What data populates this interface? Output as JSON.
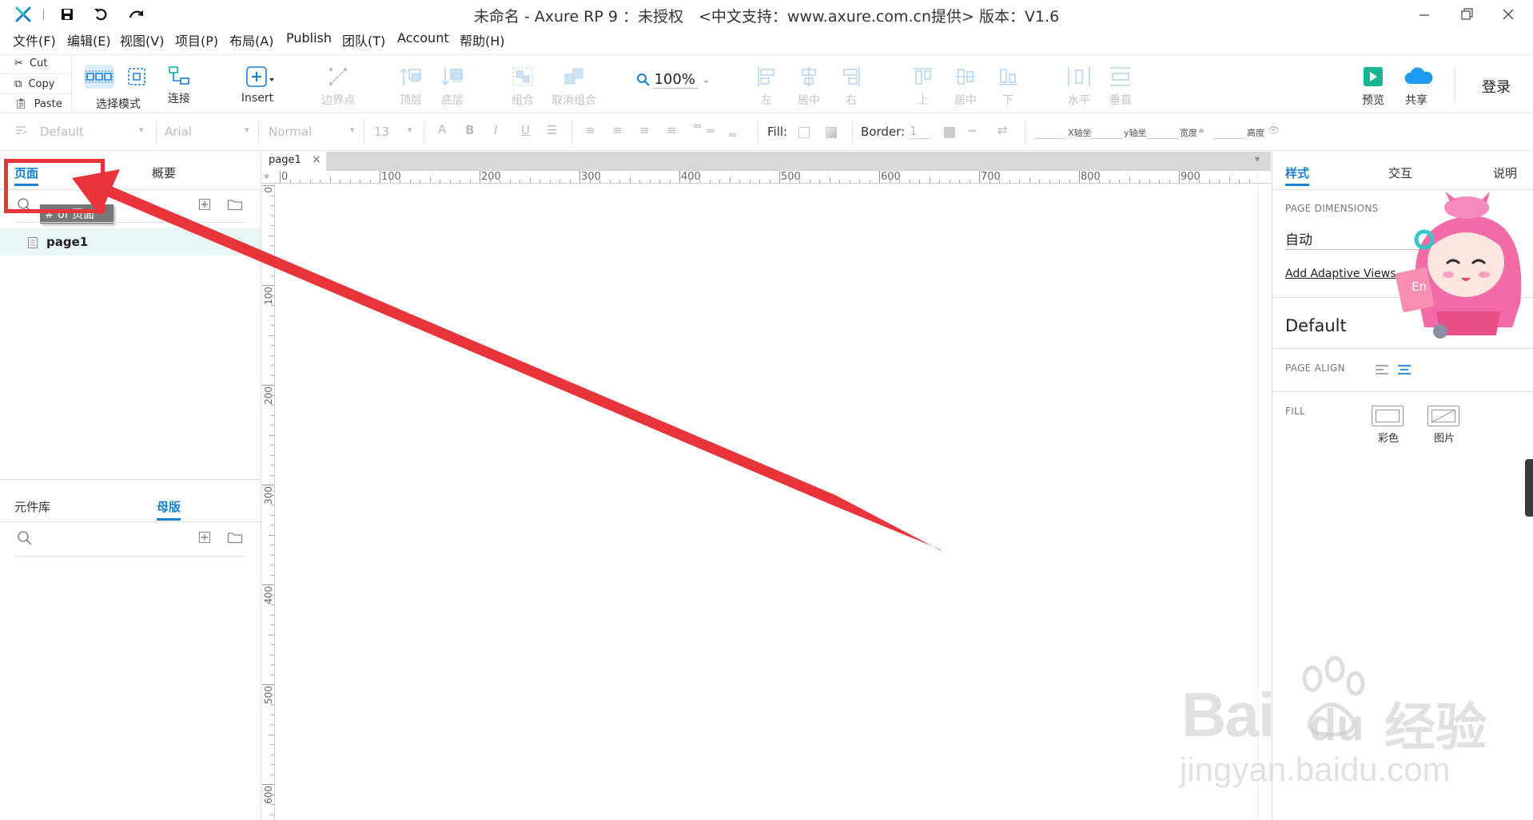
{
  "window": {
    "title": "未命名 - Axure RP 9 ：未授权　<中文支持：www.axure.com.cn提供> 版本：V1.6"
  },
  "menu": [
    "文件(F)",
    "编辑(E)",
    "视图(V)",
    "项目(P)",
    "布局(A)",
    "Publish",
    "团队(T)",
    "Account",
    "帮助(H)"
  ],
  "clipboard": {
    "cut": "Cut",
    "copy": "Copy",
    "paste": "Paste"
  },
  "toolbar": {
    "select_mode": "选择模式",
    "connect": "连接",
    "insert": "Insert",
    "points": "边界点",
    "zoom": "100%",
    "top": "顶层",
    "bottom": "底层",
    "group": "组合",
    "ungroup": "取消组合",
    "left": "左",
    "center": "居中",
    "right": "右",
    "up": "上",
    "middle": "居中",
    "down": "下",
    "horizontal": "水平",
    "vertical": "垂直",
    "preview": "预览",
    "share": "共享",
    "login": "登录"
  },
  "format": {
    "style": "Default",
    "font": "Arial",
    "weight": "Normal",
    "size": "13",
    "fill_label": "Fill:",
    "border_label": "Border:",
    "border_value": "1",
    "x_label": "X轴坐",
    "y_label": "y轴坐",
    "w_label": "宽度",
    "h_label": "高度"
  },
  "left_panel": {
    "tabs": {
      "pages": "页面",
      "outline": "概要"
    },
    "search_tooltip": "# of 页面",
    "pages": [
      "page1"
    ],
    "lib_tabs": {
      "library": "元件库",
      "masters": "母版"
    }
  },
  "canvas": {
    "doc_tab": "page1",
    "h_ticks": [
      "0",
      "100",
      "200",
      "300",
      "400",
      "500",
      "600",
      "700",
      "800",
      "900"
    ],
    "v_ticks": [
      "0",
      "100",
      "200",
      "300",
      "400",
      "500",
      "600"
    ]
  },
  "right_panel": {
    "tabs": {
      "style": "样式",
      "interact": "交互",
      "notes": "说明"
    },
    "page_dimensions_label": "PAGE DIMENSIONS",
    "page_dimensions_value": "自动",
    "adaptive_link": "Add Adaptive Views",
    "style_name": "Default",
    "page_align_label": "PAGE ALIGN",
    "fill_label": "FILL",
    "fill_color": "彩色",
    "fill_image": "图片",
    "mascot_sign": "En"
  },
  "watermark": {
    "brand": "Bai",
    "brand2": "du",
    "product": "经验",
    "url": "jingyan.baidu.com"
  },
  "colors": {
    "accent": "#1a7fd1",
    "annotation": "#e8343a",
    "preview_green": "#1ab394",
    "share_blue": "#1e9bf0"
  }
}
